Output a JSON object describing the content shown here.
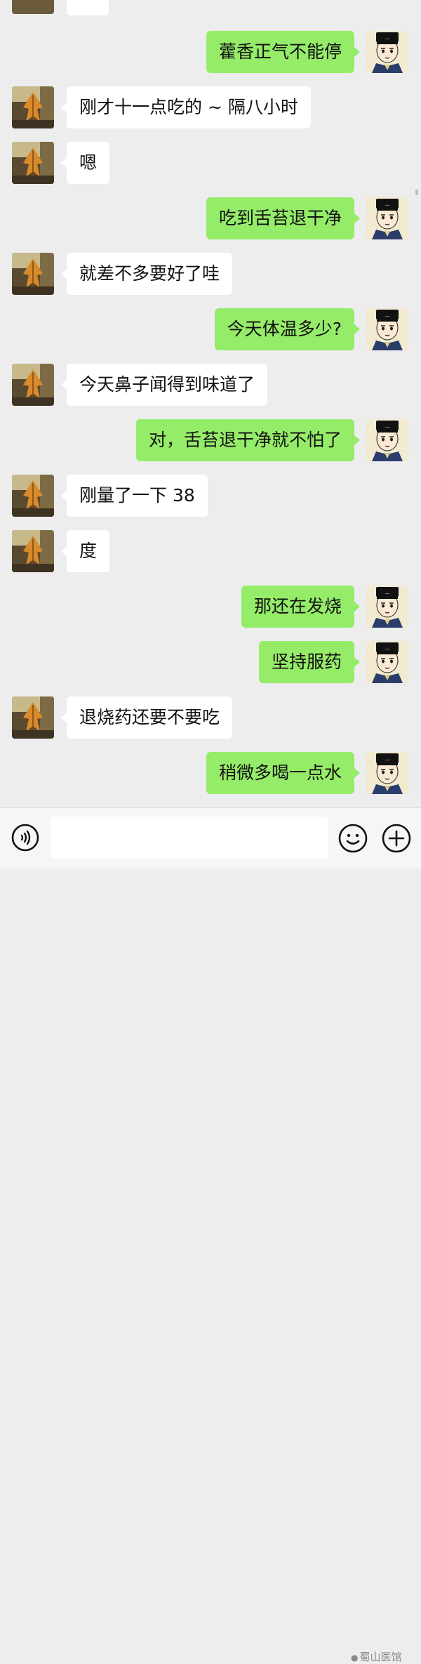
{
  "colors": {
    "background": "#ededed",
    "outgoing_bubble": "#95ec69",
    "incoming_bubble": "#ffffff"
  },
  "messages": [
    {
      "side": "right",
      "text": "藿香正气不能停"
    },
    {
      "side": "left",
      "text": "刚才十一点吃的 ~ 隔八小时"
    },
    {
      "side": "left",
      "text": "嗯"
    },
    {
      "side": "right",
      "text": "吃到舌苔退干净"
    },
    {
      "side": "left",
      "text": "就差不多要好了哇"
    },
    {
      "side": "right",
      "text": "今天体温多少?"
    },
    {
      "side": "left",
      "text": "今天鼻子闻得到味道了"
    },
    {
      "side": "right",
      "text": "对，舌苔退干净就不怕了"
    },
    {
      "side": "left",
      "text": "刚量了一下 38"
    },
    {
      "side": "left",
      "text": "度"
    },
    {
      "side": "right",
      "text": "那还在发烧"
    },
    {
      "side": "right",
      "text": "坚持服药"
    },
    {
      "side": "left",
      "text": "退烧药还要不要吃"
    },
    {
      "side": "right",
      "text": "稍微多喝一点水"
    }
  ],
  "input_bar": {
    "voice_icon": "voice-wave-icon",
    "emoji_icon": "smiley-icon",
    "plus_icon": "plus-circle-icon",
    "input_value": ""
  },
  "watermark": {
    "text": "蜀山医馆",
    "icon": "wechat-icon"
  }
}
